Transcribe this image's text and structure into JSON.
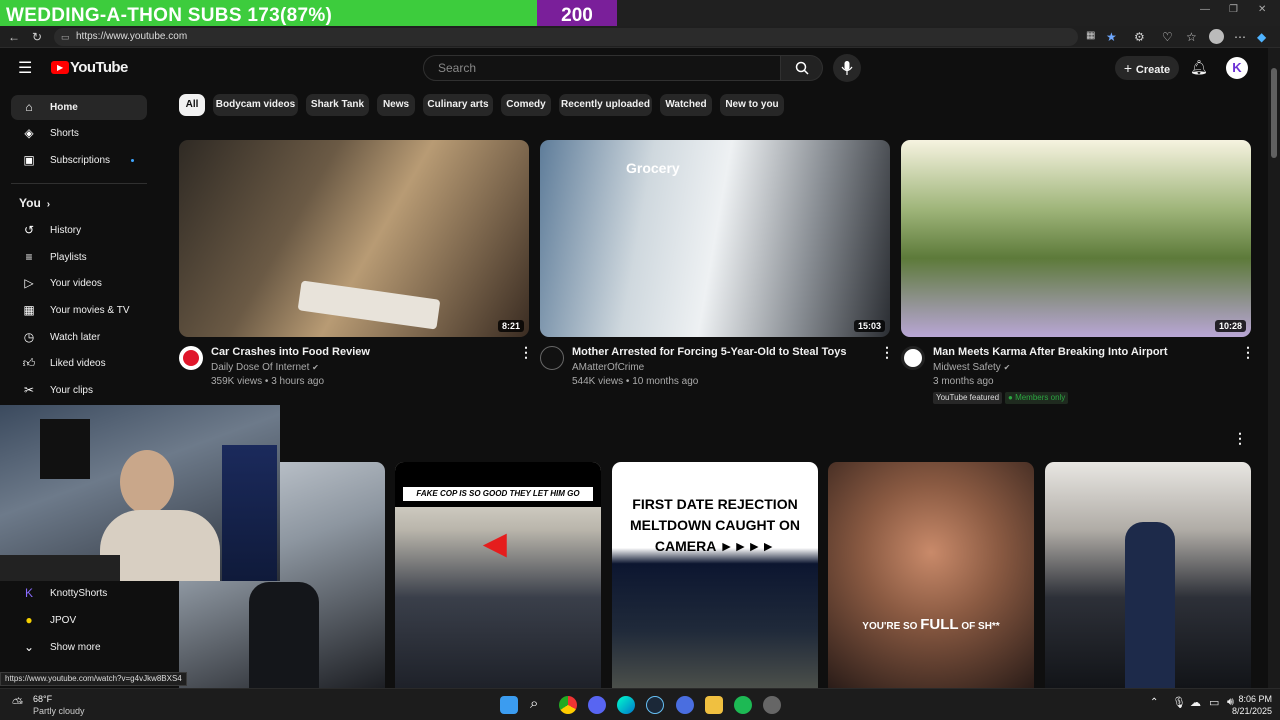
{
  "overlay": {
    "subs_label": "WEDDING-A-THON SUBS 173(87%)",
    "goal": "200",
    "progress_fraction": 0.87
  },
  "browser": {
    "url": "https://www.youtube.com",
    "status_url": "https://www.youtube.com/watch?v=g4vJkw8BXS4"
  },
  "masthead": {
    "logo_text": "YouTube",
    "search_placeholder": "Search",
    "create_label": "Create",
    "avatar_letter": "K"
  },
  "sidebar": {
    "main": [
      {
        "label": "Home",
        "icon": "home-icon"
      },
      {
        "label": "Shorts",
        "icon": "shorts-icon"
      },
      {
        "label": "Subscriptions",
        "icon": "subscriptions-icon"
      }
    ],
    "you_header": "You",
    "you_items": [
      {
        "label": "History",
        "icon": "history-icon"
      },
      {
        "label": "Playlists",
        "icon": "playlists-icon"
      },
      {
        "label": "Your videos",
        "icon": "your-videos-icon"
      },
      {
        "label": "Your movies & TV",
        "icon": "movies-icon"
      },
      {
        "label": "Watch later",
        "icon": "clock-icon"
      },
      {
        "label": "Liked videos",
        "icon": "thumbs-up-icon"
      },
      {
        "label": "Your clips",
        "icon": "scissors-icon"
      }
    ],
    "subs": [
      {
        "label": "KnottyShorts"
      },
      {
        "label": "JPOV"
      },
      {
        "label": "Show more"
      }
    ]
  },
  "chips": [
    "All",
    "Bodycam videos",
    "Shark Tank",
    "News",
    "Culinary arts",
    "Comedy",
    "Recently uploaded",
    "Watched",
    "New to you"
  ],
  "videos": [
    {
      "title": "Car Crashes into Food Review",
      "channel": "Daily Dose Of Internet",
      "meta": "359K views • 3 hours ago",
      "duration": "8:21"
    },
    {
      "title": "Mother Arrested for Forcing 5-Year-Old to Steal Toys",
      "channel": "AMatterOfCrime",
      "meta": "544K views • 10 months ago",
      "duration": "15:03"
    },
    {
      "title": "Man Meets Karma After Breaking Into Airport",
      "channel": "Midwest Safety",
      "meta": "3 months ago",
      "duration": "10:28",
      "badge_featured": "YouTube featured",
      "badge_members": "Members only"
    }
  ],
  "shorts_text": {
    "s2": "FAKE COP IS SO GOOD THEY LET HIM GO",
    "s3": "FIRST DATE REJECTION MELTDOWN CAUGHT ON CAMERA ►►►►",
    "s4_pre": "YOU'RE SO ",
    "s4_full": "FULL",
    "s4_post": " OF SH**"
  },
  "taskbar": {
    "temp": "68°F",
    "weather": "Partly cloudy",
    "time": "8:06 PM",
    "date": "8/21/2025"
  }
}
